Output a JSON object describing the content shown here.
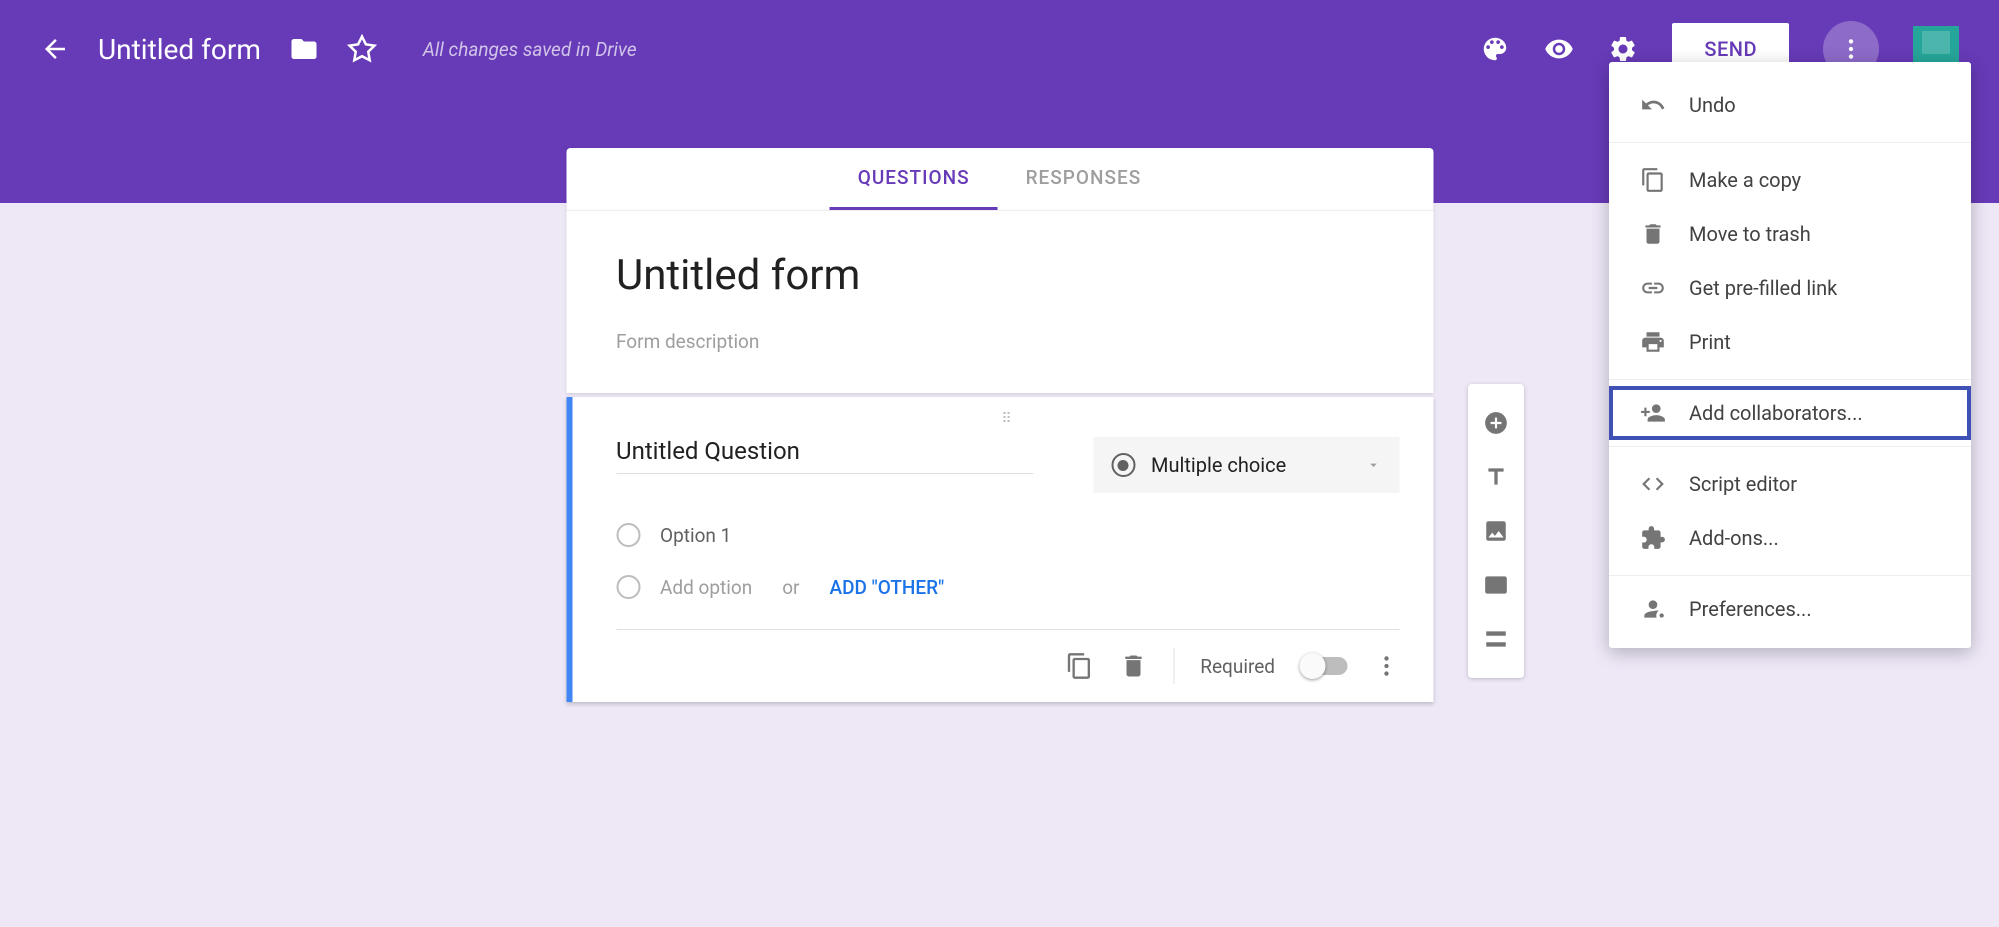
{
  "header": {
    "title": "Untitled form",
    "save_status": "All changes saved in Drive",
    "send_label": "SEND"
  },
  "tabs": {
    "questions": "QUESTIONS",
    "responses": "RESPONSES"
  },
  "form": {
    "title": "Untitled form",
    "description_placeholder": "Form description"
  },
  "question": {
    "title": "Untitled Question",
    "type_label": "Multiple choice",
    "option1": "Option 1",
    "add_option": "Add option",
    "or_label": "or",
    "add_other": "ADD \"OTHER\"",
    "required_label": "Required"
  },
  "menu": {
    "undo": "Undo",
    "copy": "Make a copy",
    "trash": "Move to trash",
    "prefilled": "Get pre-filled link",
    "print": "Print",
    "collaborators": "Add collaborators...",
    "script": "Script editor",
    "addons": "Add-ons...",
    "preferences": "Preferences..."
  }
}
